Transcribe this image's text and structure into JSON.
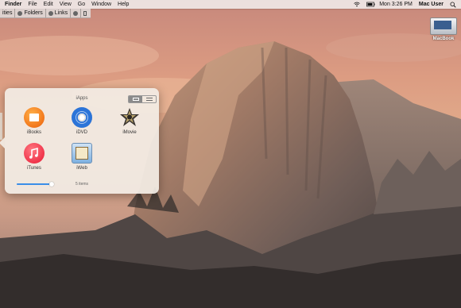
{
  "menubar": {
    "app_name": "Finder",
    "menus": [
      "File",
      "Edit",
      "View",
      "Go",
      "Window",
      "Help"
    ],
    "clock": "Mon 3:26 PM",
    "user": "Mac User"
  },
  "toolbar": {
    "items": [
      "ities",
      "Folders",
      "Links"
    ]
  },
  "desktop": {
    "drive_label": "MacBook"
  },
  "stack": {
    "title": "iApps",
    "apps": [
      {
        "label": "iBooks",
        "icon": "ibooks-icon"
      },
      {
        "label": "iDVD",
        "icon": "idvd-icon"
      },
      {
        "label": "iMovie",
        "icon": "imovie-icon"
      },
      {
        "label": "iTunes",
        "icon": "itunes-icon"
      },
      {
        "label": "iWeb",
        "icon": "iweb-icon"
      }
    ],
    "item_count": "5 items",
    "icon_size_level": 1.0
  },
  "colors": {
    "accent": "#3b8de8",
    "popover_bg": "#f2ece4"
  }
}
